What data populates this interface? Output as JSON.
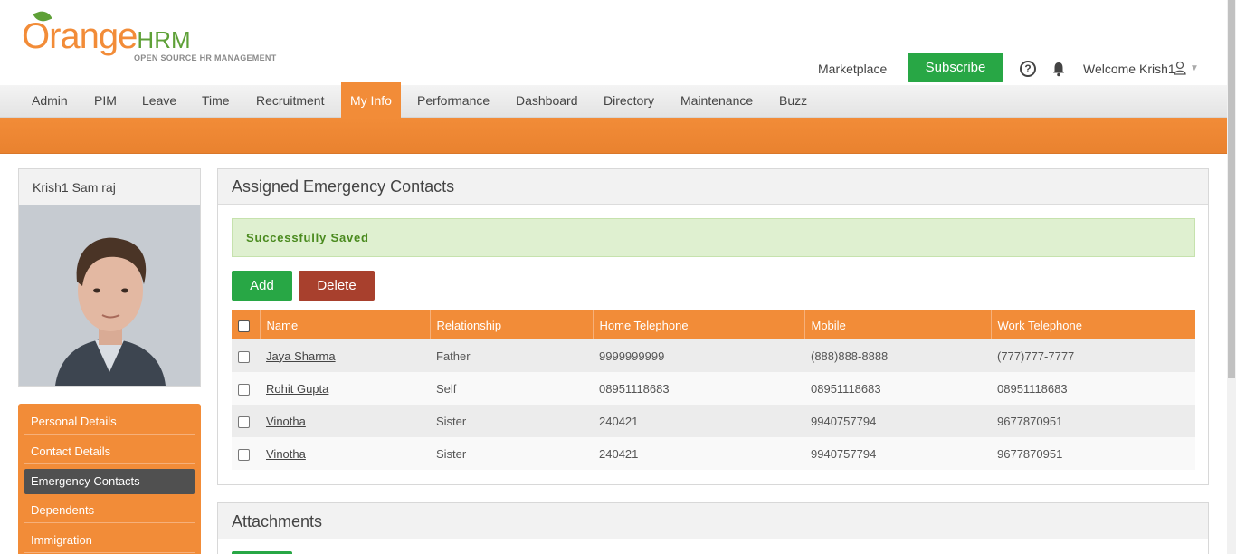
{
  "brand": {
    "logo_main": "Orange",
    "logo_hrm": "HRM",
    "logo_tagline": "OPEN SOURCE HR MANAGEMENT"
  },
  "header": {
    "marketplace": "Marketplace",
    "subscribe": "Subscribe",
    "welcome": "Welcome Krish1"
  },
  "nav": {
    "items": [
      {
        "label": "Admin"
      },
      {
        "label": "PIM"
      },
      {
        "label": "Leave"
      },
      {
        "label": "Time"
      },
      {
        "label": "Recruitment"
      },
      {
        "label": "My Info"
      },
      {
        "label": "Performance"
      },
      {
        "label": "Dashboard"
      },
      {
        "label": "Directory"
      },
      {
        "label": "Maintenance"
      },
      {
        "label": "Buzz"
      }
    ],
    "active": "My Info"
  },
  "profile": {
    "name": "Krish1 Sam raj"
  },
  "sidebar": {
    "items": [
      {
        "label": "Personal Details"
      },
      {
        "label": "Contact Details"
      },
      {
        "label": "Emergency Contacts"
      },
      {
        "label": "Dependents"
      },
      {
        "label": "Immigration"
      }
    ],
    "active": "Emergency Contacts"
  },
  "emergency": {
    "title": "Assigned Emergency Contacts",
    "message": "Successfully Saved",
    "add_label": "Add",
    "delete_label": "Delete",
    "columns": [
      "Name",
      "Relationship",
      "Home Telephone",
      "Mobile",
      "Work Telephone"
    ],
    "rows": [
      {
        "name": "Jaya Sharma",
        "relationship": "Father",
        "home": "9999999999",
        "mobile": "(888)888-8888",
        "work": "(777)777-7777"
      },
      {
        "name": "Rohit Gupta",
        "relationship": "Self",
        "home": "08951118683",
        "mobile": "08951118683",
        "work": "08951118683"
      },
      {
        "name": "Vinotha",
        "relationship": "Sister",
        "home": "240421",
        "mobile": "9940757794",
        "work": "9677870951"
      },
      {
        "name": "Vinotha",
        "relationship": "Sister",
        "home": "240421",
        "mobile": "9940757794",
        "work": "9677870951"
      }
    ]
  },
  "attachments": {
    "title": "Attachments"
  },
  "colors": {
    "orange": "#f28c38",
    "green": "#28a745",
    "red": "#a8402d"
  }
}
